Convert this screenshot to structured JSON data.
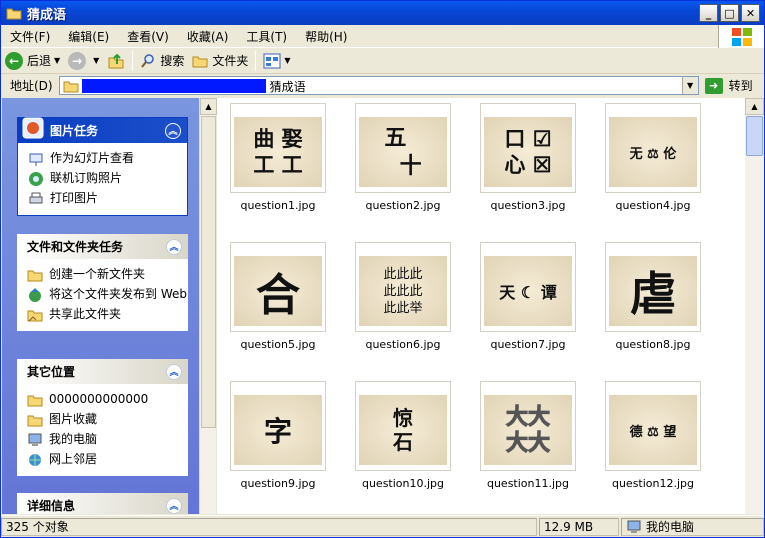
{
  "window": {
    "title": "猜成语"
  },
  "menubar": {
    "items": [
      "文件(F)",
      "编辑(E)",
      "查看(V)",
      "收藏(A)",
      "工具(T)",
      "帮助(H)"
    ]
  },
  "toolbar": {
    "back": "后退",
    "search": "搜索",
    "folders": "文件夹"
  },
  "address": {
    "label": "地址(D)",
    "path_tail": "猜成语",
    "go": "转到"
  },
  "left": {
    "picture_tasks": {
      "title": "图片任务",
      "items": [
        "作为幻灯片查看",
        "联机订购照片",
        "打印图片"
      ]
    },
    "file_tasks": {
      "title": "文件和文件夹任务",
      "items": [
        "创建一个新文件夹",
        "将这个文件夹发布到 Web",
        "共享此文件夹"
      ]
    },
    "other_places": {
      "title": "其它位置",
      "items": [
        "0000000000000",
        "图片收藏",
        "我的电脑",
        "网上邻居"
      ]
    },
    "details": {
      "title": "详细信息"
    }
  },
  "files": [
    {
      "name": "question1.jpg",
      "art": "曲 娶\n工 工"
    },
    {
      "name": "question2.jpg",
      "art": "五  \n  十"
    },
    {
      "name": "question3.jpg",
      "art": "口 ☑\n心 ☒"
    },
    {
      "name": "question4.jpg",
      "art": "无 ⚖ 伦"
    },
    {
      "name": "question5.jpg",
      "art": "合"
    },
    {
      "name": "question6.jpg",
      "art": "此此此\n此此此\n此此举"
    },
    {
      "name": "question7.jpg",
      "art": "天 ☾ 谭"
    },
    {
      "name": "question8.jpg",
      "art": "虐"
    },
    {
      "name": "question9.jpg",
      "art": "字"
    },
    {
      "name": "question10.jpg",
      "art": "惊\n石"
    },
    {
      "name": "question11.jpg",
      "art": "大大\n大大"
    },
    {
      "name": "question12.jpg",
      "art": "德 ⚖ 望"
    }
  ],
  "status": {
    "count": "325 个对象",
    "size": "12.9 MB",
    "zone": "我的电脑"
  }
}
